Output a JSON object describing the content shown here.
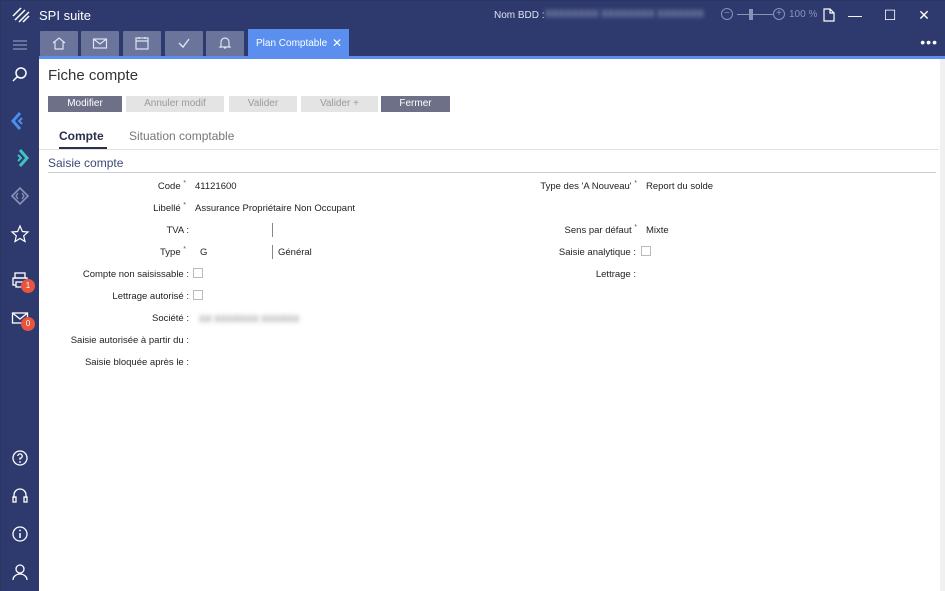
{
  "app": {
    "title": "SPI suite",
    "db_label": "Nom BDD :",
    "db_value": "XXXXXXXX  XXXXXXXX  XXXXXXX",
    "zoom": "100 %"
  },
  "window_controls": {
    "minimize": "—",
    "maximize": "☐",
    "close": "✕"
  },
  "tabs": {
    "active_label": "Plan Comptable",
    "close_glyph": "✕",
    "more_glyph": "•••"
  },
  "sidebar": {
    "print_badge": "1",
    "mail_badge": "0"
  },
  "page": {
    "title": "Fiche compte"
  },
  "actions": [
    {
      "label": "Modifier",
      "enabled": true
    },
    {
      "label": "Annuler modif",
      "enabled": false
    },
    {
      "label": "Valider",
      "enabled": false
    },
    {
      "label": "Valider +",
      "enabled": false
    },
    {
      "label": "Fermer",
      "enabled": true
    }
  ],
  "subtabs": {
    "compte": "Compte",
    "situation": "Situation comptable"
  },
  "section": {
    "title": "Saisie compte"
  },
  "form": {
    "code_label": "Code",
    "code_value": "41121600",
    "libelle_label": "Libellé",
    "libelle_value": "Assurance Propriétaire Non Occupant",
    "tva_label": "TVA :",
    "type_label": "Type",
    "type_code": "G",
    "type_name": "Général",
    "compte_non_saisissable_label": "Compte non saisissable :",
    "lettrage_autorise_label": "Lettrage autorisé :",
    "societe_label": "Société :",
    "societe_value": "XX XXXXXXX XXXXXX",
    "saisie_autorisee_label": "Saisie autorisée à partir du :",
    "saisie_bloquee_label": "Saisie bloquée après le :",
    "type_a_nouveau_label": "Type des 'A Nouveau'",
    "type_a_nouveau_value": "Report du solde",
    "sens_label": "Sens par défaut",
    "sens_value": "Mixte",
    "saisie_analytique_label": "Saisie analytique :",
    "lettrage_label": "Lettrage :",
    "required_mark": "*"
  }
}
